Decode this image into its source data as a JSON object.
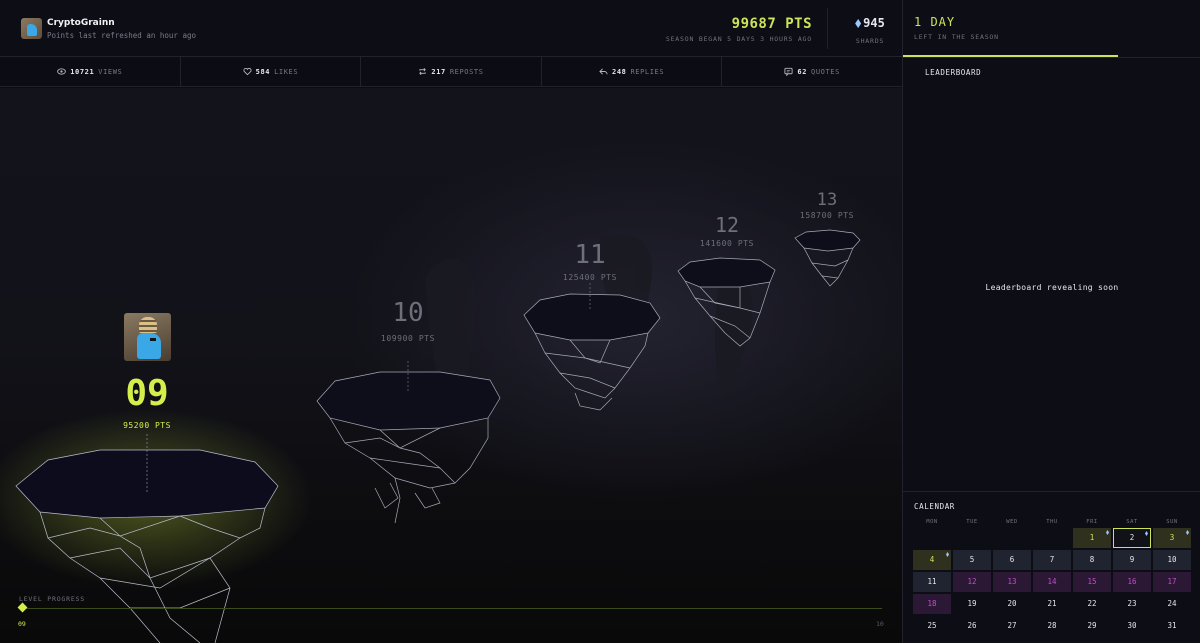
{
  "header": {
    "username": "CryptoGrainn",
    "refresh_text": "Points last refreshed an hour ago",
    "points": "99687 PTS",
    "season_text": "SEASON BEGAN 5 DAYS 3 HOURS AGO",
    "shards_value": "945",
    "shards_label": "SHARDS"
  },
  "stats": [
    {
      "icon": "eye-icon",
      "value": "10721",
      "label": "VIEWS"
    },
    {
      "icon": "heart-icon",
      "value": "584",
      "label": "LIKES"
    },
    {
      "icon": "repost-icon",
      "value": "217",
      "label": "REPOSTS"
    },
    {
      "icon": "reply-icon",
      "value": "248",
      "label": "REPLIES"
    },
    {
      "icon": "quote-icon",
      "value": "62",
      "label": "QUOTES"
    }
  ],
  "scene": {
    "current_level": "09",
    "current_points": "95200 PTS",
    "levels": [
      {
        "num": "10",
        "pts": "109900 PTS"
      },
      {
        "num": "11",
        "pts": "125400 PTS"
      },
      {
        "num": "12",
        "pts": "141600 PTS"
      },
      {
        "num": "13",
        "pts": "158700 PTS"
      }
    ],
    "progress_label": "LEVEL PROGRESS",
    "progress_start": "09",
    "progress_end": "10",
    "progress_fraction": 0.0
  },
  "right_panel": {
    "days_left": "1 DAY",
    "days_label": "LEFT IN THE SEASON",
    "season_progress": 0.72,
    "leaderboard_title": "LEADERBOARD",
    "leaderboard_message": "Leaderboard revealing soon",
    "calendar_title": "CALENDAR",
    "calendar_days": [
      "MON",
      "TUE",
      "WED",
      "THU",
      "FRI",
      "SAT",
      "SUN"
    ]
  },
  "colors": {
    "accent": "#cde35a",
    "purple": "#c34fc8",
    "background": "#0b0b12"
  }
}
